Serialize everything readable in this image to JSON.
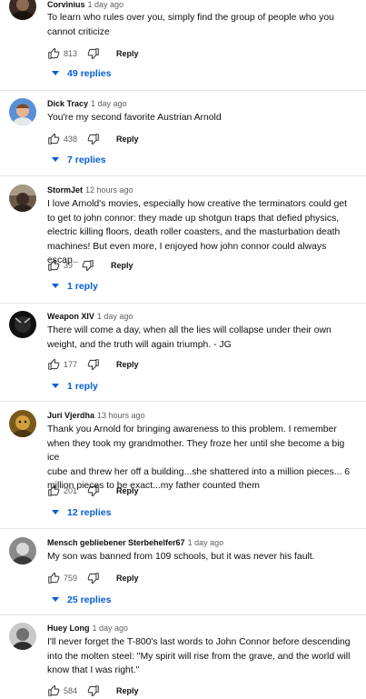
{
  "comments": [
    {
      "author": "Corvinius",
      "time": "1 day ago",
      "text": "To learn who rules over you, simply find the group of people who you\ncannot criticize",
      "likes": "813",
      "reply_label": "Reply",
      "replies": "49 replies"
    },
    {
      "author": "Dick Tracy",
      "time": "1 day ago",
      "text": "You're my second favorite Austrian Arnold",
      "likes": "438",
      "reply_label": "Reply",
      "replies": "7 replies"
    },
    {
      "author": "StormJet",
      "time": "12 hours ago",
      "text": "I love Arnold's movies, especially how creative the terminators could get\nto get to john connor: they made up shotgun traps that defied physics,\nelectric killing floors, death roller coasters, and the masturbation death\nmachines! But even more, I enjoyed how john connor could always escap..",
      "likes": "39",
      "reply_label": "Reply",
      "replies": "1 reply"
    },
    {
      "author": "Weapon XIV",
      "time": "1 day ago",
      "text": "There will come a day, when all the lies will collapse under their own\nweight, and the truth will again triumph. - JG",
      "likes": "177",
      "reply_label": "Reply",
      "replies": "1 reply"
    },
    {
      "author": "Juri Vjerdha",
      "time": "13 hours ago",
      "text": "Thank you Arnold for bringing awareness to this problem. I remember\nwhen they took my grandmother. They froze her until she become a big ice\ncube and threw her off a building...she shattered into a million pieces... 6\nmillion pieces to be exact...my father counted them",
      "likes": "201",
      "reply_label": "Reply",
      "replies": "12 replies"
    },
    {
      "author": "Mensch gebliebener Sterbehelfer67",
      "time": "1 day ago",
      "text": "My son was banned from 109 schools, but it was never his fault.",
      "likes": "759",
      "reply_label": "Reply",
      "replies": "25 replies"
    },
    {
      "author": "Huey Long",
      "time": "1 day ago",
      "text": "I'll never forget the T-800's last words to John Connor before descending\ninto the molten steel: \"My spirit will rise from the grave, and the world will\nknow that I was right.\"",
      "likes": "584",
      "reply_label": "Reply",
      "replies": ""
    }
  ],
  "icons": {
    "like": "thumb-up-icon",
    "dislike": "thumb-down-icon",
    "expand": "triangle-down-icon"
  },
  "colors": {
    "link": "#065fd4",
    "secondary_text": "#606060",
    "divider": "#e5e5e5"
  }
}
